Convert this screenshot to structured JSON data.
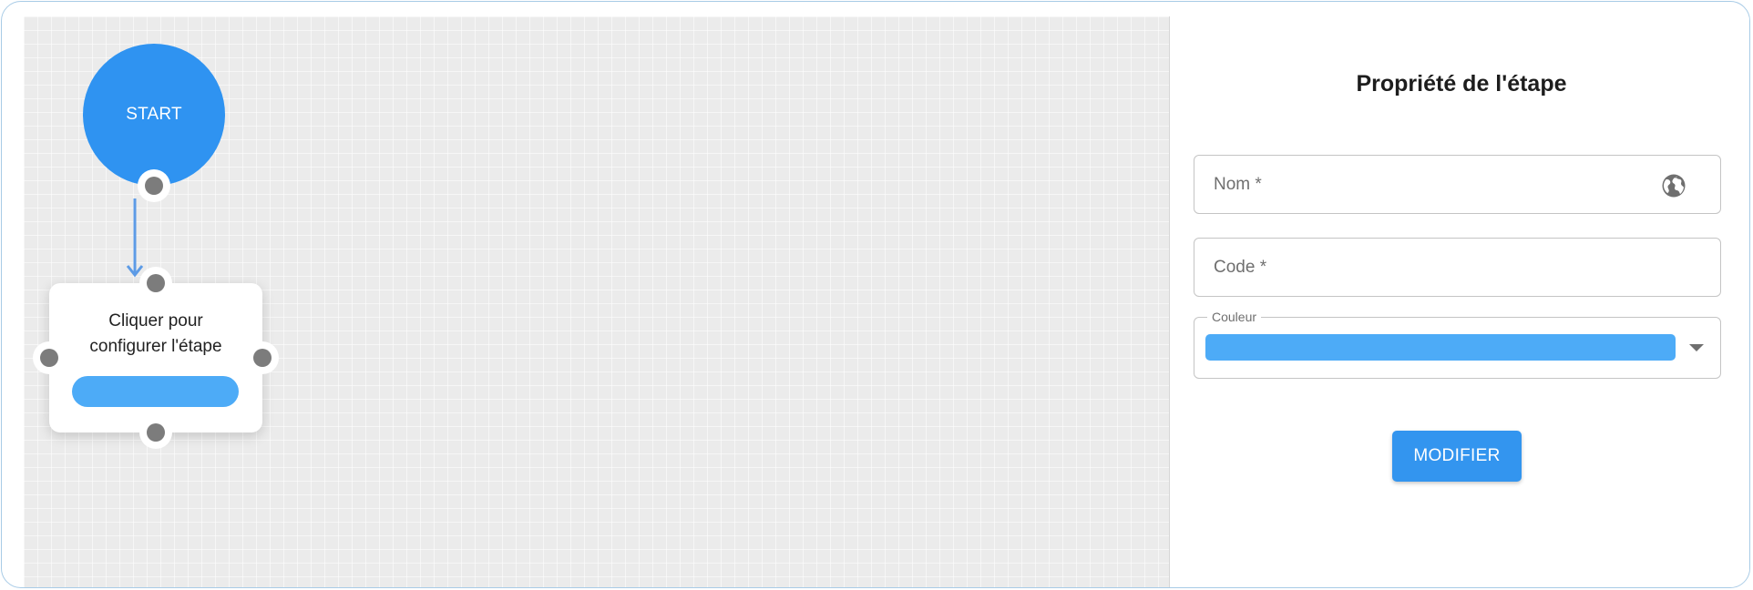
{
  "canvas": {
    "start_node": {
      "label": "START"
    },
    "step_node": {
      "text": "Cliquer pour\nconfigurer l'étape",
      "color": "#4dabf7"
    }
  },
  "panel": {
    "title": "Propriété de l'étape",
    "fields": {
      "name": {
        "label": "Nom *",
        "value": "",
        "icon": "globe-icon"
      },
      "code": {
        "label": "Code *",
        "value": ""
      },
      "color": {
        "label": "Couleur",
        "value": "#4dabf7",
        "icon": "chevron-down-icon"
      }
    },
    "submit_label": "MODIFIER"
  },
  "colors": {
    "start_node": "#2f93f1",
    "accent": "#3395ef",
    "connector": "#5d9be6"
  }
}
